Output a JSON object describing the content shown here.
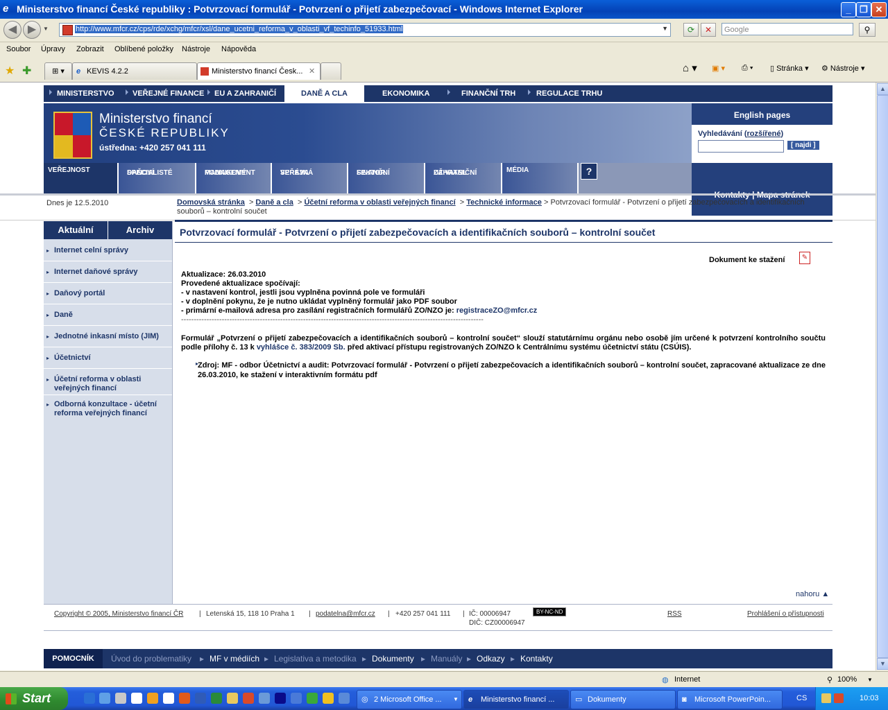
{
  "window": {
    "title": "Ministerstvo financí České republiky : Potvrzovací formulář - Potvrzení o přijetí zabezpečovací - Windows Internet Explorer"
  },
  "address": {
    "url": "http://www.mfcr.cz/cps/rde/xchg/mfcr/xsl/dane_ucetni_reforma_v_oblasti_vf_techinfo_51933.html",
    "search_placeholder": "Google"
  },
  "menu": [
    "Soubor",
    "Úpravy",
    "Zobrazit",
    "Oblíbené položky",
    "Nástroje",
    "Nápověda"
  ],
  "tabs": [
    {
      "label": "KEVIS 4.2.2"
    },
    {
      "label": "Ministerstvo financí Česk..."
    }
  ],
  "commands": {
    "page": "Stránka",
    "tools": "Nástroje"
  },
  "site": {
    "topnav": [
      "MINISTERSTVO",
      "VEŘEJNÉ FINANCE",
      "EU A ZAHRANIČÍ",
      "DANĚ A CLA",
      "EKONOMIKA",
      "FINANČNÍ TRH",
      "REGULACE TRHU"
    ],
    "brand": {
      "line1": "Ministerstvo financí",
      "line2": "ČESKÉ REPUBLIKY",
      "phone": "ústředna: +420 257 041 111"
    },
    "english": "English pages",
    "search": {
      "label": "Vyhledávání",
      "advanced": "rozšířené",
      "button": "[ najdi ]"
    },
    "contacts": "Kontakty | Mapa stránek",
    "subnav": [
      {
        "l1": "VEŘEJNOST",
        "l2": ""
      },
      {
        "l1": "DAŇOVÍ",
        "l2": "SPECIALISTÉ"
      },
      {
        "l1": "PODNIKOVÝ",
        "l2": "MANAGEMENT"
      },
      {
        "l1": "VEŘEJNÁ",
        "l2": "SPRÁVA"
      },
      {
        "l1": "FINANČNÍ",
        "l2": "SEKTOR"
      },
      {
        "l1": "ZAHRANIČNÍ",
        "l2": "UŽIVATEL"
      },
      {
        "l1": "MÉDIA",
        "l2": ""
      }
    ],
    "help_icon": "?"
  },
  "date": "Dnes je 12.5.2010",
  "breadcrumb": {
    "home": "Domovská stránka",
    "c1": "Daně a cla",
    "c2": "Účetní reforma v oblasti veřejných financí",
    "c3": "Technické informace",
    "current": "Potvrzovací formulář - Potvrzení o přijetí zabezpečovacích a identifikačních souborů – kontrolní součet"
  },
  "sidebar": {
    "tab_current": "Aktuální",
    "tab_archive": "Archiv",
    "items": [
      "Internet celní správy",
      "Internet daňové správy",
      "Daňový portál",
      "Daně",
      "Jednotné inkasní místo (JIM)",
      "Účetnictví",
      "Účetní reforma v oblasti veřejných financí",
      "Odborná konzultace - účetní reforma veřejných financí"
    ]
  },
  "content": {
    "title": "Potvrzovací formulář - Potvrzení o přijetí zabezpečovacích a identifikačních souborů – kontrolní součet",
    "download": "Dokument ke stažení",
    "update": "Aktualizace: 26.03.2010",
    "changes_intro": "Provedené aktualizace spočívají:",
    "change1": "- v nastavení kontrol, jestli jsou vyplněna povinná pole ve formuláři",
    "change2": "- v doplnění pokynu, že je nutno ukládat vyplněný formulář jako PDF soubor",
    "change3_prefix": "- primární e-mailová adresa pro zasílání registračních formulářů ZO/NZO je: ",
    "email": "registraceZO@mfcr.cz",
    "dashes": "-----------------------------------------------------------------------------------------------------------------------",
    "para_a": "Formulář „Potvrzení o přijetí zabezpečovacích a identifikačních souborů – kontrolní součet“ slouží statutárnímu orgánu nebo osobě jím určené k potvrzení kontrolního součtu podle přílohy č. 13 k ",
    "para_link": "vyhlášce č. 383/2009 Sb.",
    "para_b": " před aktivací přístupu registrovaných ZO/NZO k Centrálnímu systému účetnictví státu (CSÚIS).",
    "source": "Zdroj: MF - odbor Účetnictví a audit: Potvrzovací formulář - Potvrzení o přijetí zabezpečovacích a identifikačních souborů – kontrolní součet, zapracované aktualizace  ze dne 26.03.2010, ke stažení v interaktivním formátu pdf",
    "top": "nahoru"
  },
  "footer": {
    "copyright": "Copyright © 2005, Ministerstvo financí ČR",
    "address": "Letenská 15, 118 10 Praha 1",
    "email": "podatelna@mfcr.cz",
    "phone": "+420 257 041 111",
    "ic": "IČ: 00006947",
    "dic": "DIČ: CZ00006947",
    "cc": "BY-NC-ND",
    "rss": "RSS",
    "access": "Prohlášení o přístupnosti"
  },
  "helpbar": {
    "label": "POMOCNÍK",
    "items": [
      "Úvod do problematiky",
      "MF v médiích",
      "Legislativa a metodika",
      "Dokumenty",
      "Manuály",
      "Odkazy",
      "Kontakty"
    ]
  },
  "status": {
    "zone": "Internet",
    "zoom": "100%"
  },
  "taskbar": {
    "start": "Start",
    "tasks": [
      "2 Microsoft Office ...",
      "Ministerstvo financí ...",
      "Dokumenty",
      "Microsoft PowerPoin..."
    ],
    "lang": "CS",
    "clock": "10:03"
  }
}
